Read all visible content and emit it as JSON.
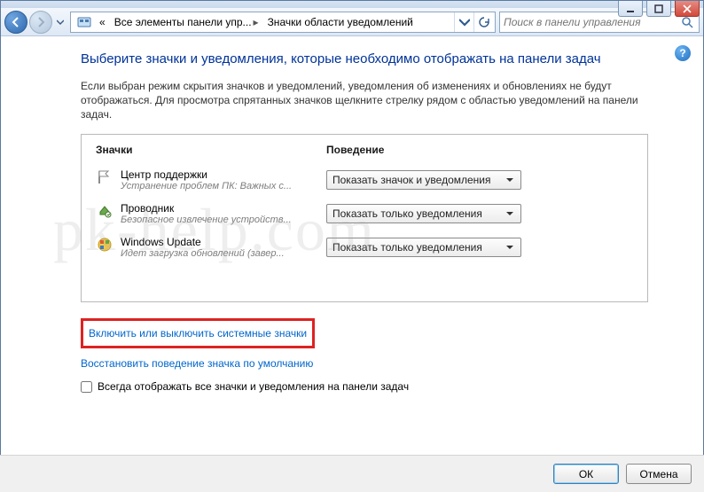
{
  "window": {
    "minimize_tip": "Свернуть",
    "maximize_tip": "Развернуть",
    "close_tip": "Закрыть"
  },
  "breadcrumb": {
    "root_icon": "control-panel",
    "seg1": "Все элементы панели упр...",
    "seg2": "Значки области уведомлений"
  },
  "search": {
    "placeholder": "Поиск в панели управления"
  },
  "help_tip": "?",
  "heading": "Выберите значки и уведомления, которые необходимо отображать на панели задач",
  "description": "Если выбран режим скрытия значков и уведомлений, уведомления об изменениях и обновлениях не будут отображаться. Для просмотра спрятанных значков щелкните стрелку рядом с областью уведомлений на панели задач.",
  "columns": {
    "icons": "Значки",
    "behavior": "Поведение"
  },
  "items": [
    {
      "title": "Центр поддержки",
      "subtitle": "Устранение проблем ПК: Важных с...",
      "behavior": "Показать значок и уведомления"
    },
    {
      "title": "Проводник",
      "subtitle": "Безопасное извлечение устройств...",
      "behavior": "Показать только уведомления"
    },
    {
      "title": "Windows Update",
      "subtitle": "Идет загрузка обновлений (завер...",
      "behavior": "Показать только уведомления"
    }
  ],
  "links": {
    "system_icons": "Включить или выключить системные значки",
    "restore_defaults": "Восстановить поведение значка по умолчанию"
  },
  "checkbox_label": "Всегда отображать все значки и уведомления на панели задач",
  "buttons": {
    "ok": "ОК",
    "cancel": "Отмена"
  },
  "watermark": "pk-help.com"
}
